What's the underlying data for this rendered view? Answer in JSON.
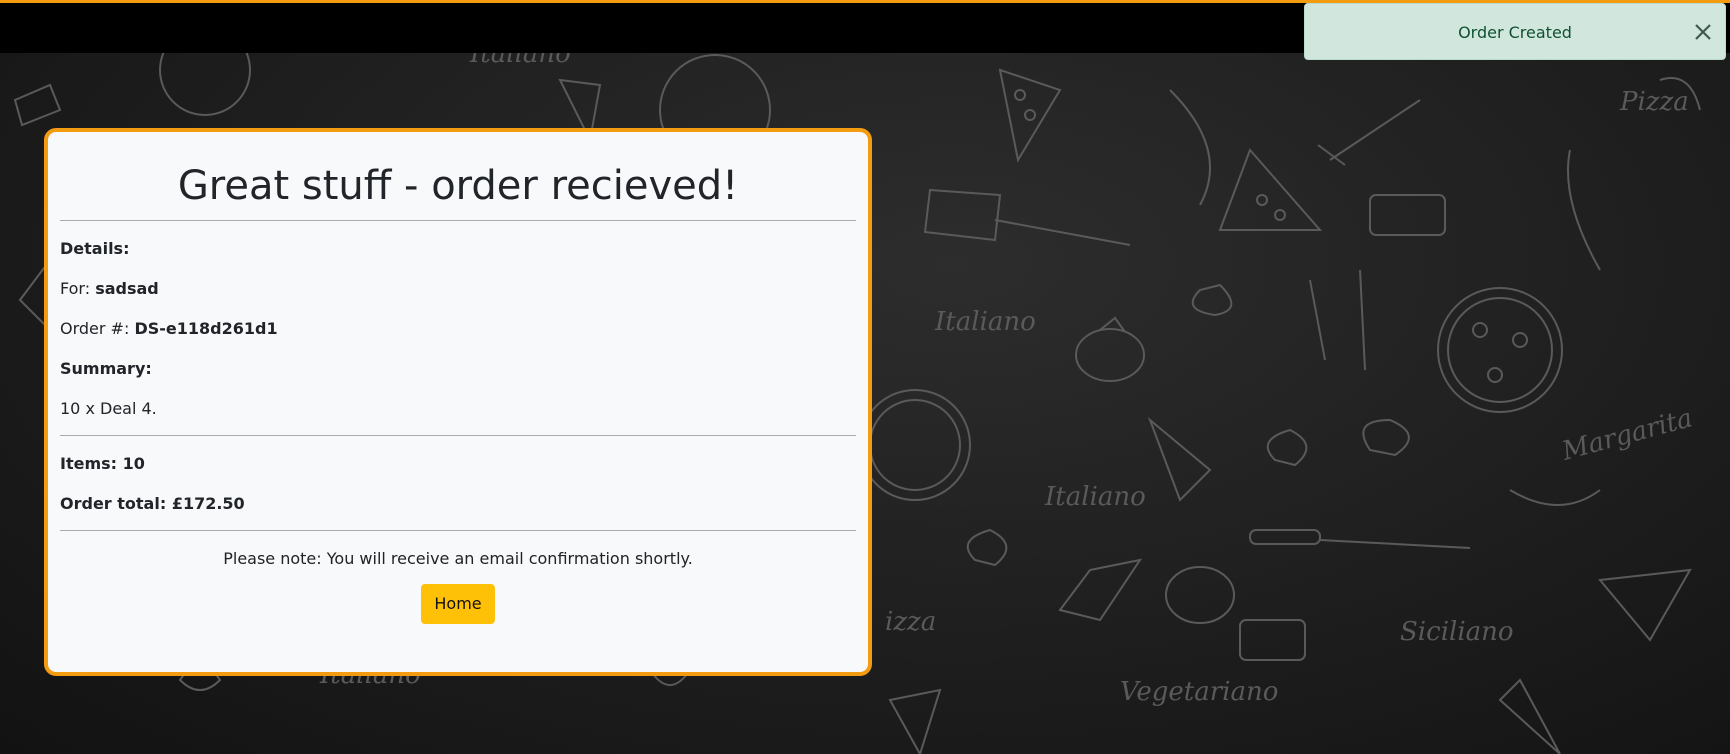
{
  "toast": {
    "message": "Order Created",
    "close_icon": "close-icon"
  },
  "confirmation": {
    "title": "Great stuff - order recieved!",
    "details_label": "Details:",
    "for_label": "For:",
    "customer_name": "sadsad",
    "order_number_label": "Order #:",
    "order_number": "DS-e118d261d1",
    "summary_label": "Summary:",
    "summary_items": "10 x Deal 4.",
    "items_label": "Items:",
    "items_count": "10",
    "total_label": "Order total:",
    "total_value": "£172.50",
    "note": "Please note: You will receive an email confirmation shortly.",
    "home_button": "Home"
  },
  "background": {
    "doodle_words": [
      "Italiano",
      "Pizza",
      "Italiano",
      "Margarita",
      "Italiano",
      "izza",
      "Siciliano",
      "Vegetariano",
      "Italiano"
    ]
  },
  "colors": {
    "accent": "#f39c12",
    "button": "#ffc107",
    "toast_bg": "#d1e7dd",
    "toast_text": "#0f5132"
  }
}
